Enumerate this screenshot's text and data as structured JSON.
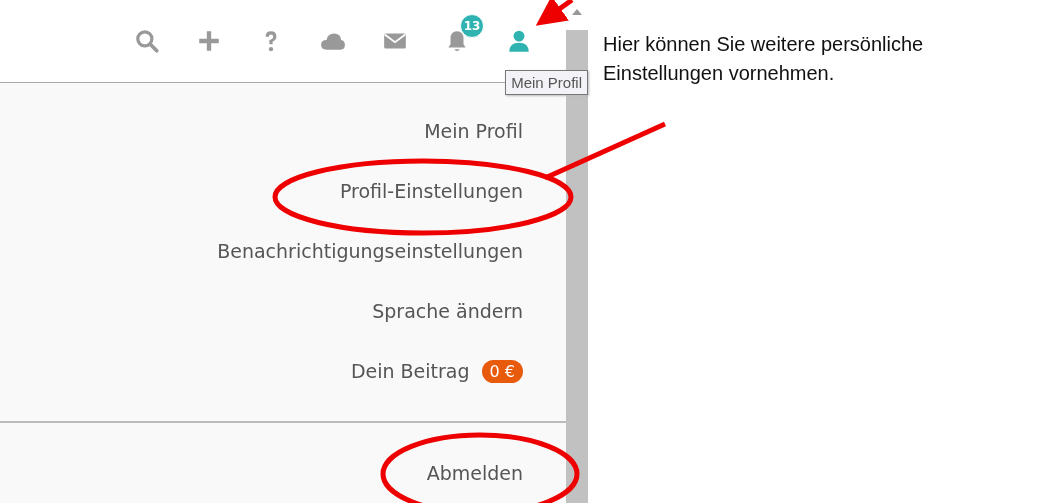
{
  "toolbar": {
    "icons": [
      {
        "kind": "search",
        "active": false
      },
      {
        "kind": "plus",
        "active": false
      },
      {
        "kind": "help",
        "active": false
      },
      {
        "kind": "cloud",
        "active": false
      },
      {
        "kind": "mail",
        "active": false
      },
      {
        "kind": "bell",
        "active": false,
        "badge": "13"
      },
      {
        "kind": "user",
        "active": true
      }
    ]
  },
  "tooltip": "Mein Profil",
  "menu": {
    "items": [
      {
        "label": "Mein Profil"
      },
      {
        "label": "Profil-Einstellungen"
      },
      {
        "label": "Benachrichtigungseinstellungen"
      },
      {
        "label": "Sprache ändern"
      },
      {
        "label": "Dein Beitrag",
        "badge": "0 €"
      }
    ],
    "footer_items": [
      {
        "label": "Abmelden"
      }
    ]
  },
  "annotation": "Hier können Sie weitere persönliche Einstellungen vornehmen."
}
